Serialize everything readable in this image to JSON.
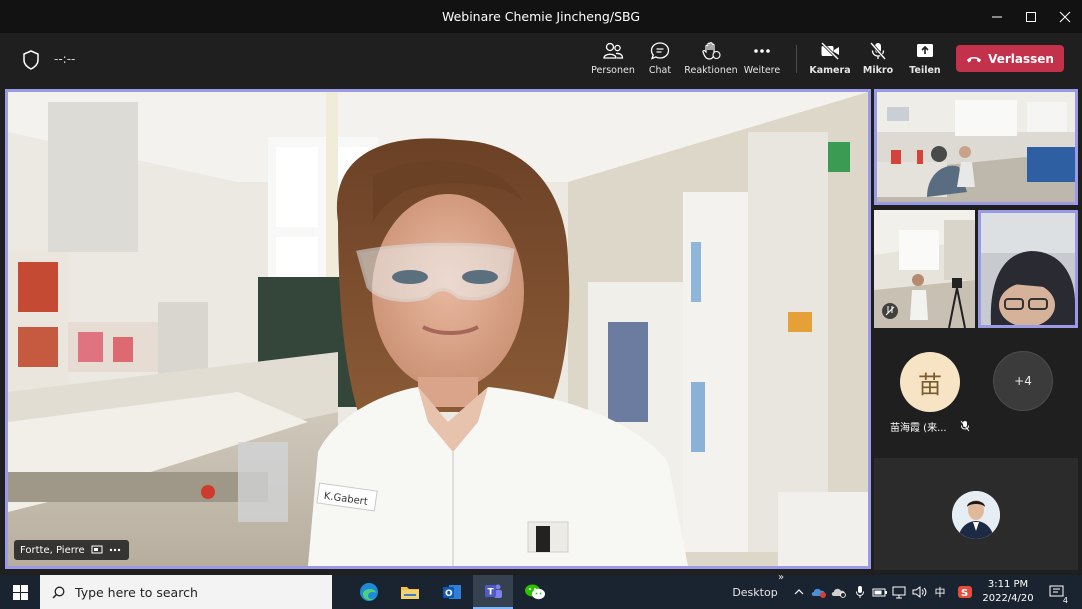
{
  "window": {
    "title": "Webinare Chemie Jincheng/SBG"
  },
  "meeting": {
    "timer": "--:--",
    "toolbar": {
      "people": "Personen",
      "chat": "Chat",
      "reactions": "Reaktionen",
      "more": "Weitere",
      "camera": "Kamera",
      "mic": "Mikro",
      "share": "Teilen",
      "leave": "Verlassen"
    },
    "main_speaker": {
      "name": "Fortte, Pierre",
      "badge": "K.Gabert"
    },
    "participants": {
      "avatar_initial": "苗",
      "avatar_name": "苗海霞 (来...",
      "overflow_count": "+4"
    },
    "colors": {
      "accent": "#9a9ae6",
      "leave": "#c4314b",
      "avatar_bg": "#f7e4c4"
    }
  },
  "taskbar": {
    "search_placeholder": "Type here to search",
    "desktop_label": "Desktop",
    "ime": "中",
    "time": "3:11 PM",
    "date": "2022/4/20",
    "notification_count": "4"
  }
}
